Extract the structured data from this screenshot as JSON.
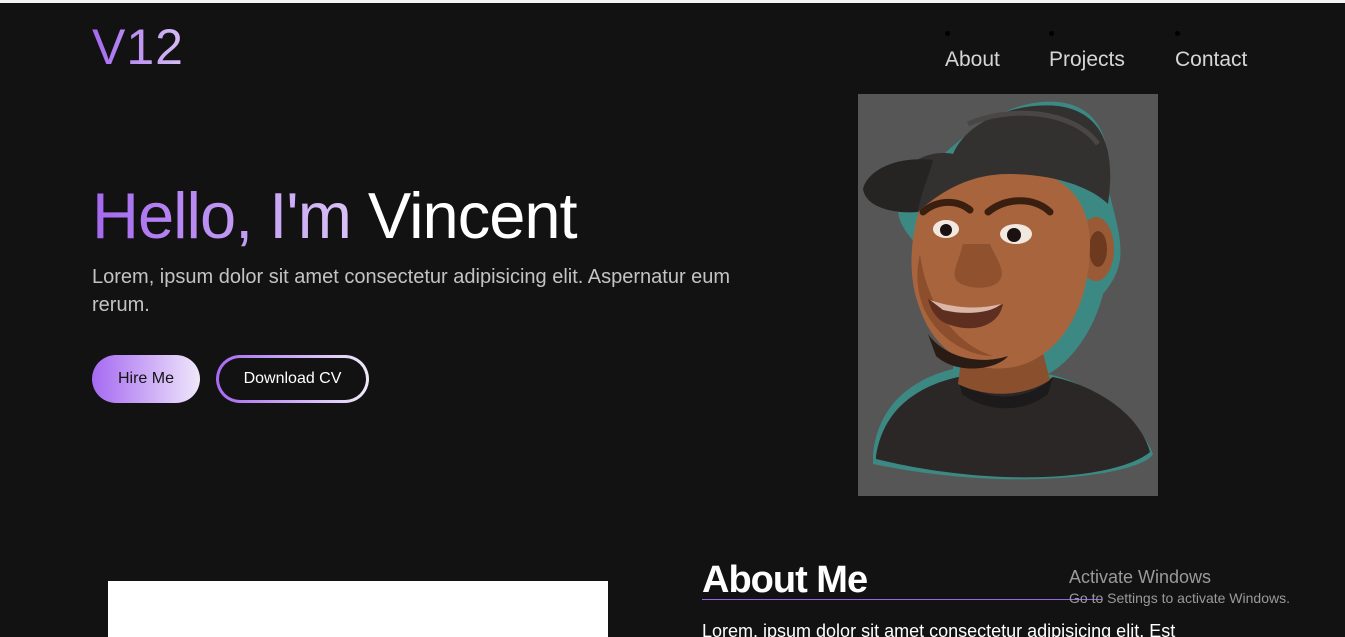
{
  "logo": "V12",
  "nav": {
    "items": [
      {
        "label": "About"
      },
      {
        "label": "Projects"
      },
      {
        "label": "Contact"
      }
    ]
  },
  "hero": {
    "greeting": "Hello, I'm ",
    "name": "Vincent",
    "text": "Lorem, ipsum dolor sit amet consectetur adipisicing elit. Aspernatur eum rerum.",
    "hire_label": "Hire Me",
    "cv_label": "Download CV"
  },
  "about": {
    "title": "About Me",
    "text": "Lorem, ipsum dolor sit amet consectetur adipisicing elit. Est"
  },
  "watermark": {
    "title": "Activate Windows",
    "subtitle": "Go to Settings to activate Windows."
  },
  "colors": {
    "background": "#131213",
    "accent": "#a568f0",
    "accent_light": "#dcc8f6"
  }
}
